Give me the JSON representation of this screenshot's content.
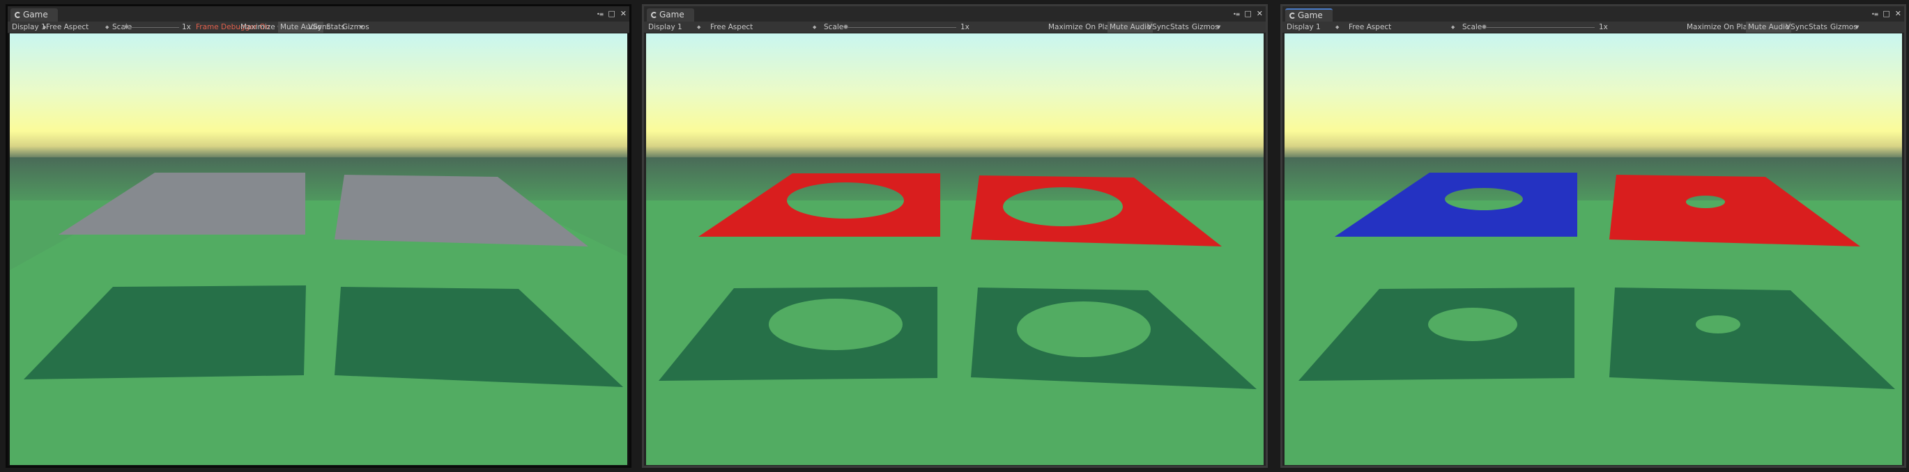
{
  "panels": [
    {
      "tab_label": "Game",
      "toolbar": {
        "display": "Display 1",
        "aspect": "Free Aspect",
        "scale_label": "Scale",
        "scale_value": "1x",
        "frame_debugger": "Frame Debugger On",
        "maximize": "Maximize On Play",
        "mute": "Mute Audio",
        "vsync": "VSync",
        "stats": "Stats",
        "gizmos": "Gizmos"
      },
      "scene": {
        "left_plane_color": "#868a8f",
        "right_plane_color": "#868a8f",
        "left_hole": false,
        "right_hole": false
      }
    },
    {
      "tab_label": "Game",
      "toolbar": {
        "display": "Display 1",
        "aspect": "Free Aspect",
        "scale_label": "Scale",
        "scale_value": "1x",
        "maximize": "Maximize On Play",
        "mute": "Mute Audio",
        "vsync": "VSync",
        "stats": "Stats",
        "gizmos": "Gizmos"
      },
      "scene": {
        "left_plane_color": "#d91e1e",
        "right_plane_color": "#d91e1e",
        "left_hole": true,
        "right_hole": true
      }
    },
    {
      "tab_label": "Game",
      "toolbar": {
        "display": "Display 1",
        "aspect": "Free Aspect",
        "scale_label": "Scale",
        "scale_value": "1x",
        "maximize": "Maximize On Play",
        "mute": "Mute Audio",
        "vsync": "VSync",
        "stats": "Stats",
        "gizmos": "Gizmos"
      },
      "scene": {
        "left_plane_color": "#2432c2",
        "right_plane_color": "#d91e1e",
        "left_hole": true,
        "right_hole": true,
        "small_right_hole": true
      }
    }
  ],
  "colors": {
    "ground": "#52ac62",
    "shadow": "#267048",
    "sky_top": "#c9f6f0",
    "sky_yellow": "#fbfb9a",
    "horizon_dark": "#4a6b58"
  }
}
